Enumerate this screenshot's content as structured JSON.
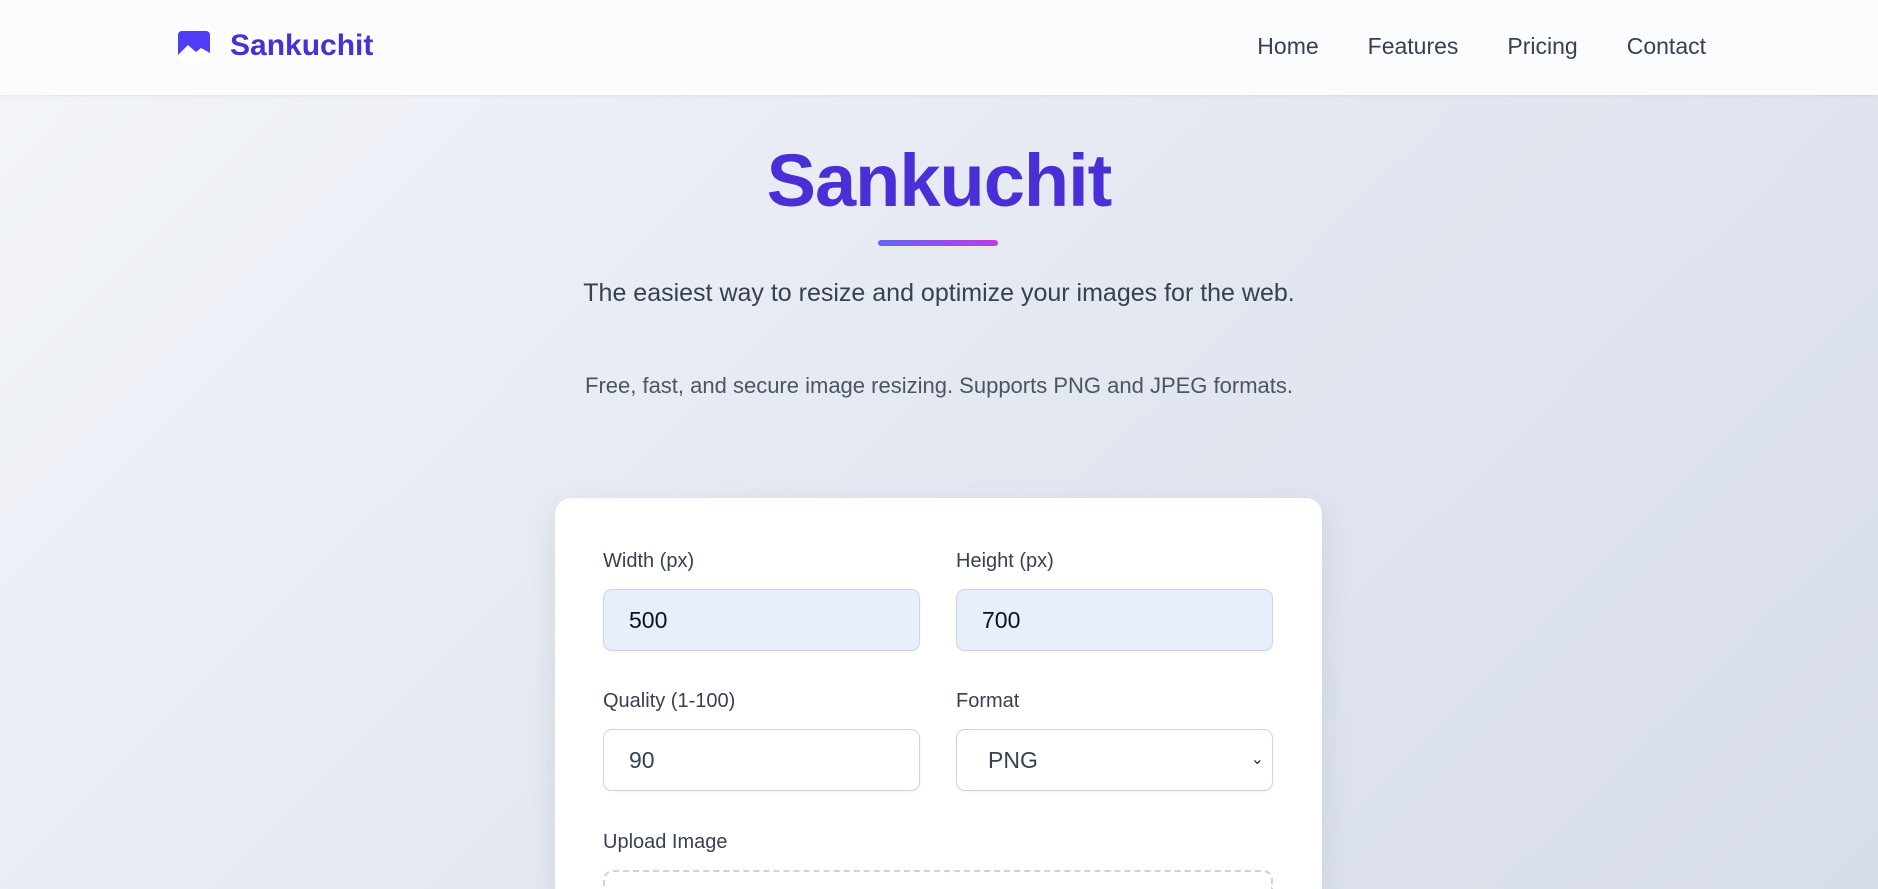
{
  "nav": {
    "brand": "Sankuchit",
    "links": [
      "Home",
      "Features",
      "Pricing",
      "Contact"
    ]
  },
  "hero": {
    "title": "Sankuchit",
    "tagline": "The easiest way to resize and optimize your images for the web.",
    "description": "Free, fast, and secure image resizing. Supports PNG and JPEG formats."
  },
  "form": {
    "width_label": "Width (px)",
    "width_value": "500",
    "height_label": "Height (px)",
    "height_value": "700",
    "quality_label": "Quality (1-100)",
    "quality_value": "90",
    "format_label": "Format",
    "format_value": "PNG",
    "upload_label": "Upload Image"
  },
  "colors": {
    "brand": "#4a2fd6"
  }
}
